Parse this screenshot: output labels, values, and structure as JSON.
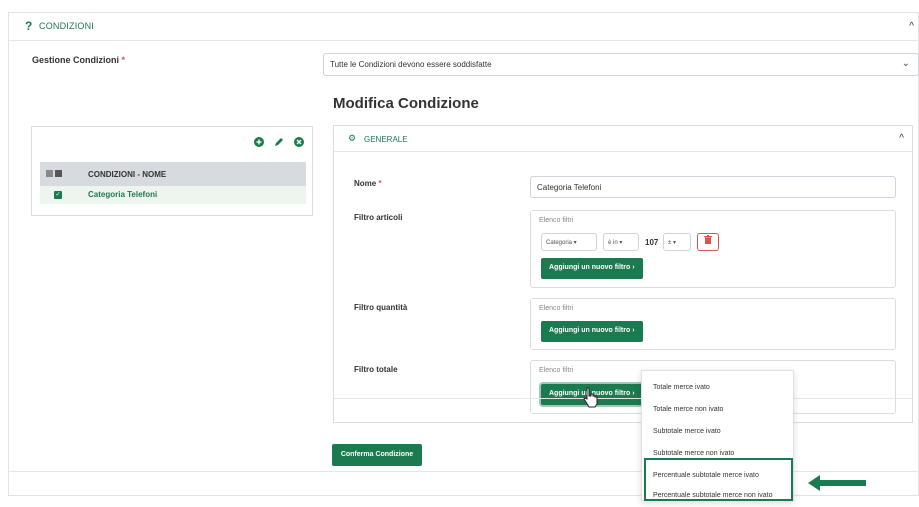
{
  "header": {
    "title": "CONDIZIONI",
    "q_icon": "?"
  },
  "gestione": {
    "label": "Gestione Condizioni",
    "required": "*",
    "selected": "Tutte le Condizioni devono essere soddisfatte"
  },
  "modifica_title": "Modifica Condizione",
  "left_panel": {
    "head_label": "CONDIZIONI - NOME",
    "row_label": "Categoria Telefoni"
  },
  "general": {
    "title": "GENERALE",
    "nome_label": "Nome",
    "nome_required": "*",
    "nome_value": "Categoria Telefoni",
    "filtro_articoli_label": "Filtro articoli",
    "filtro_quantita_label": "Filtro quantità",
    "filtro_totale_label": "Filtro totale",
    "elenco_filtri": "Elenco filtri",
    "add_filter": "Aggiungi un nuovo filtro",
    "filter_row": {
      "field": "Categoria",
      "operator": "è in",
      "value": "107",
      "extra": "±"
    }
  },
  "confirm_label": "Conferma Condizione",
  "dropdown_items": [
    "Totale merce ivato",
    "Totale merce non ivato",
    "Subtotale merce ivato",
    "Subtotale merce non ivato",
    "Percentuale subtotale merce ivato",
    "Percentuale subtotale merce non ivato"
  ],
  "colors": {
    "accent": "#1b7a4f",
    "danger": "#d9534f",
    "header_row": "#d7dbe0"
  }
}
